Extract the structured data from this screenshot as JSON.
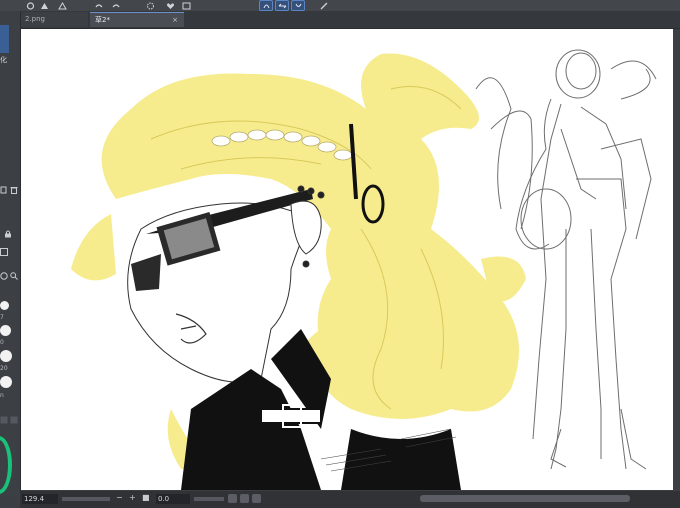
{
  "tabs": [
    {
      "label": "2.png",
      "active": false
    },
    {
      "label": "草2*",
      "active": true,
      "close_icon": "×"
    }
  ],
  "left_panel": {
    "text": "化",
    "size_labels": [
      "7",
      "0",
      "20",
      "n"
    ]
  },
  "canvas": {
    "content": "illustration: blonde character with sunglasses and braided hair, pencil sketch on right"
  },
  "status": {
    "zoom": "129.4",
    "angle": "0.0",
    "minus": "−",
    "plus": "+"
  },
  "colors": {
    "hair": "#f6ec8e",
    "accent": "#5a86c8",
    "wheel": "#19c27a"
  }
}
